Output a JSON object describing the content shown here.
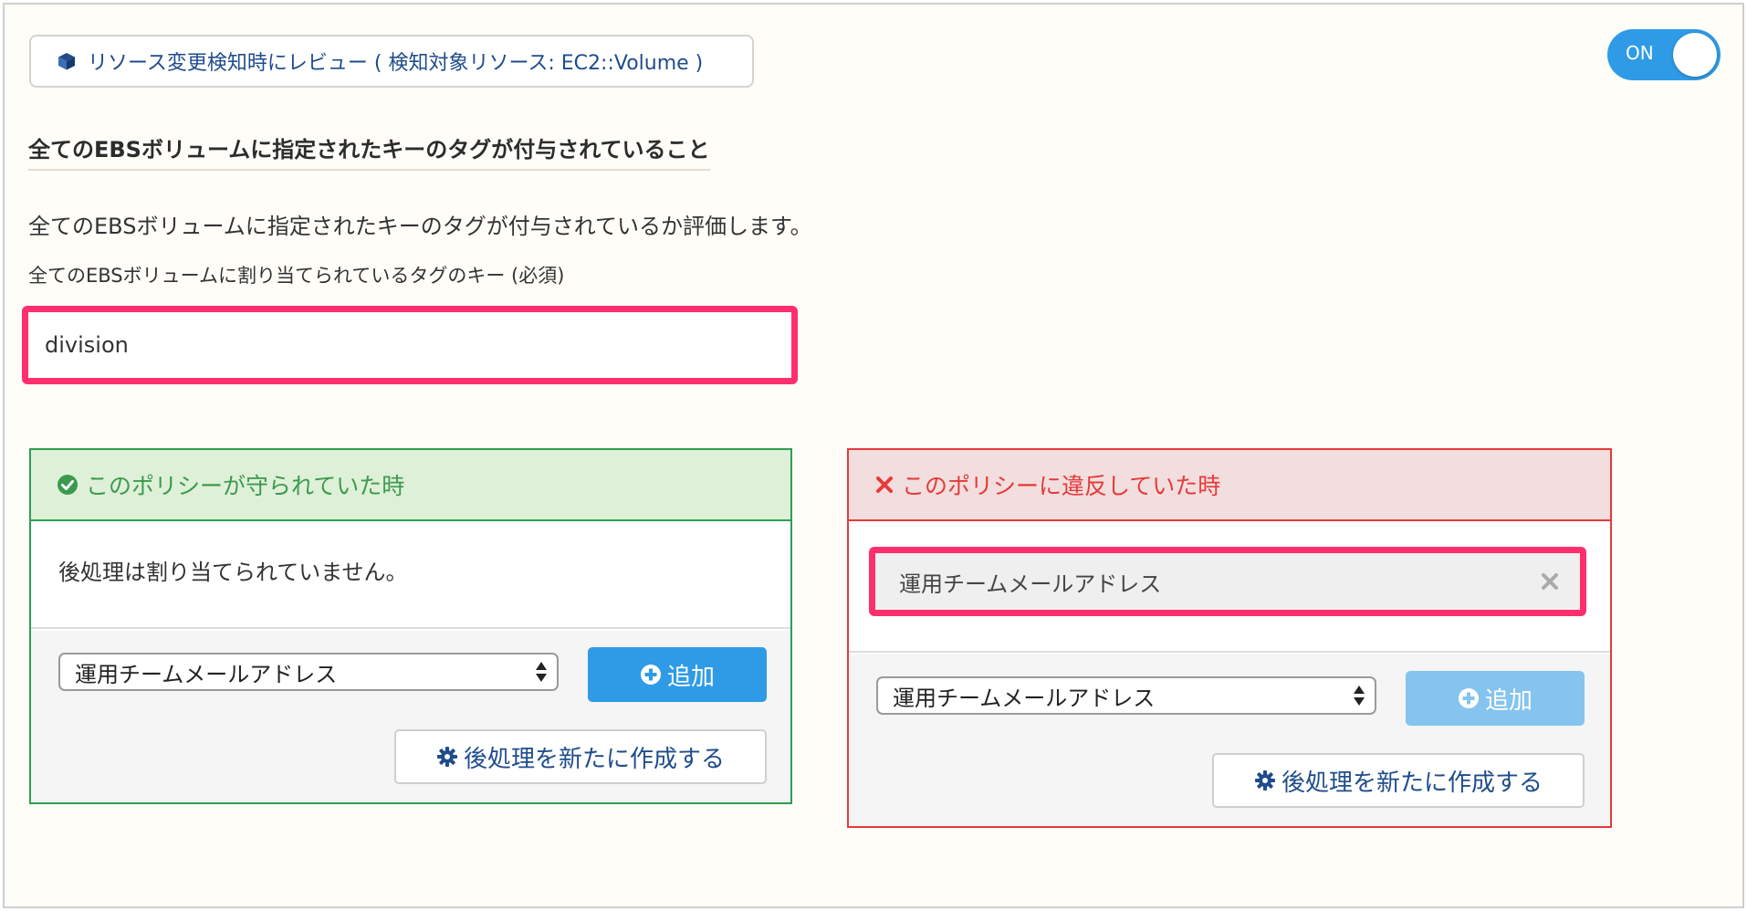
{
  "trigger": {
    "label": "リソース変更検知時にレビュー ( 検知対象リソース: EC2::Volume )",
    "icon": "cube-icon"
  },
  "toggle": {
    "label": "ON",
    "state": "on",
    "color": "#2f9be6"
  },
  "policy": {
    "title": "全てのEBSボリュームに指定されたキーのタグが付与されていること",
    "description": "全てのEBSボリュームに指定されたキーのタグが付与されているか評価します。"
  },
  "tag_key_field": {
    "label": "全てのEBSボリュームに割り当てられているタグのキー (必須)",
    "value": "division"
  },
  "compliant_panel": {
    "heading": "このポリシーが守られていた時",
    "icon": "check-circle-icon",
    "accent_color": "#3c9a4e",
    "empty_message": "後処理は割り当てられていません。",
    "select_value": "運用チームメールアドレス",
    "add_label": "追加",
    "create_label": "後処理を新たに作成する"
  },
  "violation_panel": {
    "heading": "このポリシーに違反していた時",
    "icon": "x-icon",
    "accent_color": "#e53a3a",
    "assigned_item": "運用チームメールアドレス",
    "select_value": "運用チームメールアドレス",
    "add_label": "追加",
    "create_label": "後処理を新たに作成する"
  },
  "highlight_color": "#ff2f6e"
}
